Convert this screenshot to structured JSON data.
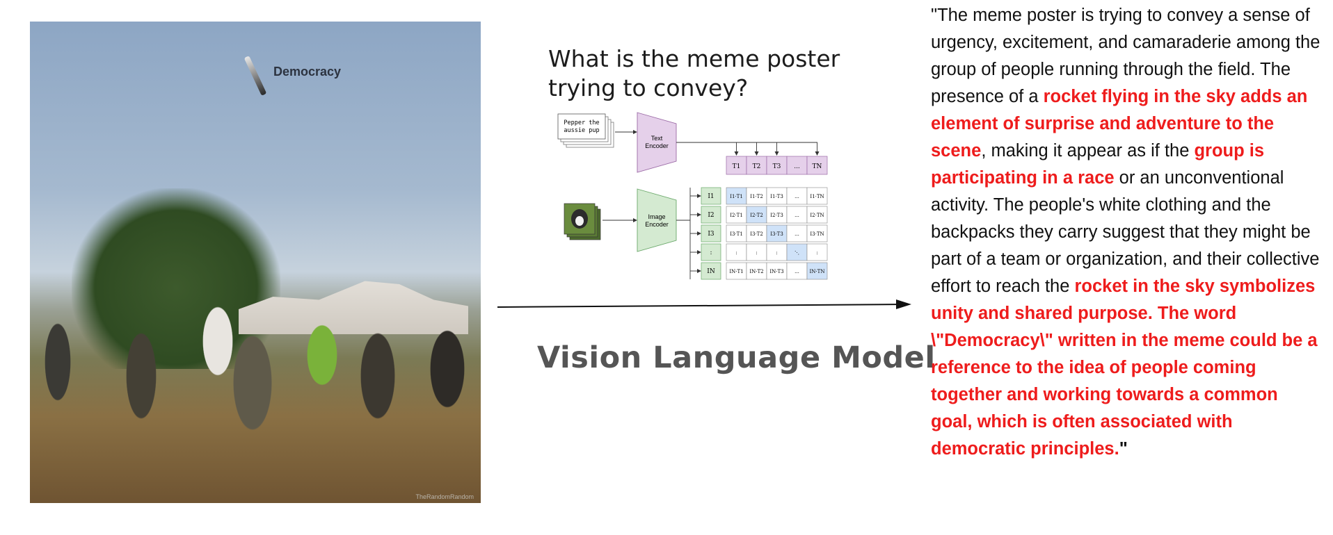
{
  "photo": {
    "rocket_label": "Democracy",
    "watermark": "TheRandomRandom"
  },
  "question": "What is the meme poster trying to convey?",
  "clip_diagram": {
    "text_input": [
      "Pepper the",
      "aussie pup"
    ],
    "text_encoder": [
      "Text",
      "Encoder"
    ],
    "image_encoder": [
      "Image",
      "Encoder"
    ],
    "text_tokens": [
      "T1",
      "T2",
      "T3",
      "...",
      "TN"
    ],
    "image_tokens": [
      "I1",
      "I2",
      "I3",
      ":",
      "IN"
    ],
    "matrix": [
      [
        "I1·T1",
        "I1·T2",
        "I1·T3",
        "...",
        "I1·TN"
      ],
      [
        "I2·T1",
        "I2·T2",
        "I2·T3",
        "...",
        "I2·TN"
      ],
      [
        "I3·T1",
        "I3·T2",
        "I3·T3",
        "...",
        "I3·TN"
      ],
      [
        ":",
        ":",
        ":",
        "⋱",
        ":"
      ],
      [
        "IN·T1",
        "IN·T2",
        "IN·T3",
        "...",
        "IN·TN"
      ]
    ],
    "colors": {
      "text_encoder": "#e5d0ea",
      "image_encoder": "#d4ead1",
      "diagonal": "#cfe2f8"
    }
  },
  "model_label": "Vision Language Model",
  "answer": [
    {
      "text": "\"",
      "style": "plain"
    },
    {
      "text": "The meme poster is trying to convey a sense of urgency, excitement, and camaraderie among the group of people running through the field. The presence of a ",
      "style": "plain"
    },
    {
      "text": "rocket flying in the sky adds an element of surprise and adventure to the scene",
      "style": "hl"
    },
    {
      "text": ", making it appear as if the ",
      "style": "plain"
    },
    {
      "text": "group is participating in a race",
      "style": "hl"
    },
    {
      "text": " or an unconventional activity. The people's white clothing and the backpacks they carry suggest that they might be part of a team or organization, and their collective effort to reach the ",
      "style": "plain"
    },
    {
      "text": "rocket in the sky symbolizes unity and shared purpose. The word \\\"Democracy\\\" written in the meme could be a reference to the idea of people coming together and working towards a common goal, which is often associated with democratic principles.",
      "style": "hl"
    },
    {
      "text": "\"",
      "style": "q"
    }
  ],
  "colors": {
    "highlight": "#ee1c1c"
  }
}
